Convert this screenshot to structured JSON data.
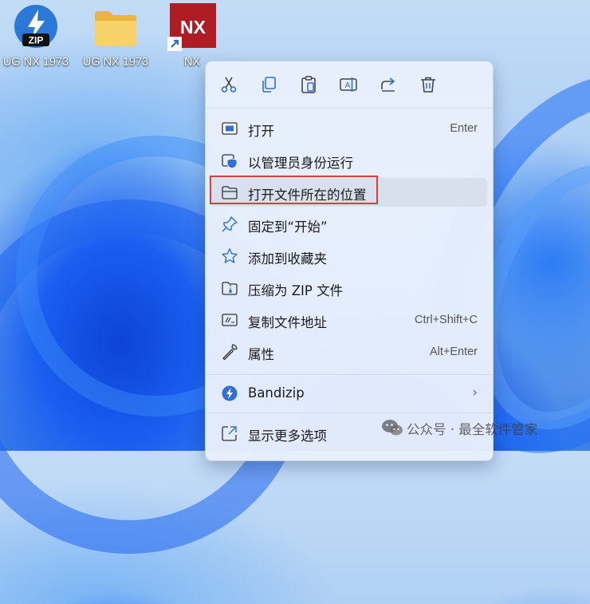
{
  "desktop": {
    "icons": [
      {
        "label": "UG NX 1973",
        "type": "zip"
      },
      {
        "label": "UG NX 1973",
        "type": "folder"
      },
      {
        "label": "NX",
        "type": "shortcut",
        "badge": "NX"
      }
    ]
  },
  "context_menu": {
    "action_bar": [
      "cut-icon",
      "copy-icon",
      "paste-icon",
      "rename-icon",
      "share-icon",
      "delete-icon"
    ],
    "items": [
      {
        "label": "打开",
        "shortcut": "Enter",
        "icon": "open-icon"
      },
      {
        "label": "以管理员身份运行",
        "shortcut": "",
        "icon": "shield-icon"
      },
      {
        "label": "打开文件所在的位置",
        "shortcut": "",
        "icon": "folder-icon",
        "highlighted": true
      },
      {
        "label": "固定到“开始”",
        "shortcut": "",
        "icon": "pin-icon"
      },
      {
        "label": "添加到收藏夹",
        "shortcut": "",
        "icon": "star-icon"
      },
      {
        "label": "压缩为 ZIP 文件",
        "shortcut": "",
        "icon": "zip-icon"
      },
      {
        "label": "复制文件地址",
        "shortcut": "Ctrl+Shift+C",
        "icon": "copy-path-icon"
      },
      {
        "label": "属性",
        "shortcut": "Alt+Enter",
        "icon": "wrench-icon"
      },
      {
        "label": "Bandizip",
        "shortcut": "",
        "icon": "bandizip-icon",
        "submenu": true
      },
      {
        "label": "显示更多选项",
        "shortcut": "",
        "icon": "more-options-icon"
      }
    ],
    "submenu_glyph": "›"
  },
  "watermark": {
    "text": "公众号 · 最全软件管家"
  },
  "colors": {
    "highlight_border": "#e23a3a",
    "accent": "#2f6fd6",
    "nx_brand": "#b01c24"
  }
}
